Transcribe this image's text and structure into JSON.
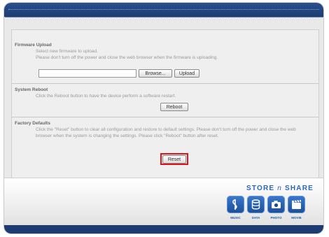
{
  "firmware": {
    "title": "Firmware Upload",
    "line1": "Select new firmware to upload.",
    "line2": "Please don't turn off the power and close the web browser when the firmware is uploading.",
    "file_value": "",
    "browse_label": "Browse...",
    "upload_label": "Upload"
  },
  "reboot": {
    "title": "System Reboot",
    "desc": "Click the Reboot button to have the device perform a software restart.",
    "button_label": "Reboot"
  },
  "factory": {
    "title": "Factory Defaults",
    "desc": "Click the \"Reset\" button to clear all configuration and restore to default settings. Please don't turn off the power and close the web browser when the system is changing the settings. Please click \"Reboot\" button after reset.",
    "button_label": "Reset"
  },
  "brand": {
    "text_a": "STORE",
    "text_n": "n",
    "text_b": "SHARE",
    "tiles": [
      "MUSIC",
      "DATA",
      "PHOTO",
      "MOVIE"
    ]
  },
  "colors": {
    "top_bar": "#1d3c72",
    "highlight": "#e0121a",
    "brand": "#2c68b8"
  }
}
